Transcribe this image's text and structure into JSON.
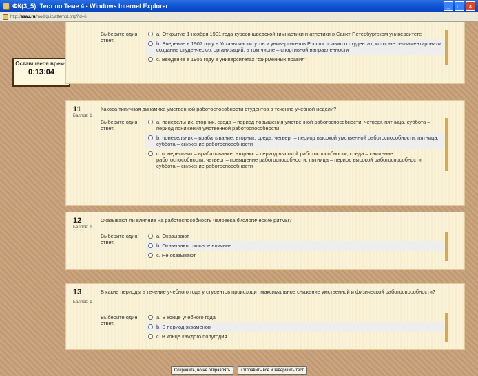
{
  "window": {
    "title": "ФК(3_5): Тест по Теме 4 - Windows Internet Explorer"
  },
  "address": {
    "prefix": "http://",
    "host": "ssau.ru",
    "path": "/mod/quiz/attempt.php?id=6"
  },
  "timer": {
    "label": "Оставшееся время",
    "value": "0:13:04"
  },
  "questions": [
    {
      "prompt": "Выберите один ответ.",
      "answers": [
        "a. Открытие 1 ноября 1901 года курсов шведской гимнастики и атлетики в Санкт-Петербургском университете",
        "b. Введение в 1907 году в Уставы институтов и университетов России правил о студентах, которые регламентировали создание студенческих организаций, в том числе – спортивной направленности",
        "c. Введение в 1905 году в университетах \"фирменных правил\""
      ]
    },
    {
      "number": "11",
      "grade": "Баллов: 1",
      "text": "Какова типичная динамика умственной работоспособности студентов в течение учебной недели?",
      "prompt": "Выберите один ответ.",
      "answers": [
        "a. понедельник, вторник, среда – период повышения умственной работоспособности, четверг, пятница, суббота – период понижения умственной работоспособности",
        "b. понедельник – врабатывание, вторник, среда, четверг – период высокой умственной работоспособности, пятница, суббота – снижение работоспособности",
        "c. понедельник – врабатывание, вторник – период высокой работоспособности, среда – снижение работоспособности, четверг – повышение работоспособности, пятница – период высокой работоспособности, суббота – снижение работоспособности"
      ]
    },
    {
      "number": "12",
      "grade": "Баллов: 1",
      "text": "Оказывают ли влияние на работоспособность человека биологические ритмы?",
      "prompt": "Выберите один ответ.",
      "answers": [
        "a. Оказывают",
        "b. Оказывают сильное влияние",
        "c. Не оказывают"
      ]
    },
    {
      "number": "13",
      "grade": "Баллов: 1",
      "text": "В какие периоды в течение учебного года у студентов происходит максимальное снижение умственной и физической работоспособности?",
      "prompt": "Выберите один ответ.",
      "answers": [
        "a. В конце учебного года",
        "b. В период экзаменов",
        "c. В конце каждого полугодия"
      ]
    }
  ],
  "footer": {
    "save_label": "Сохранить, но не отправлять",
    "submit_label": "Отправить всё и завершить тест"
  }
}
